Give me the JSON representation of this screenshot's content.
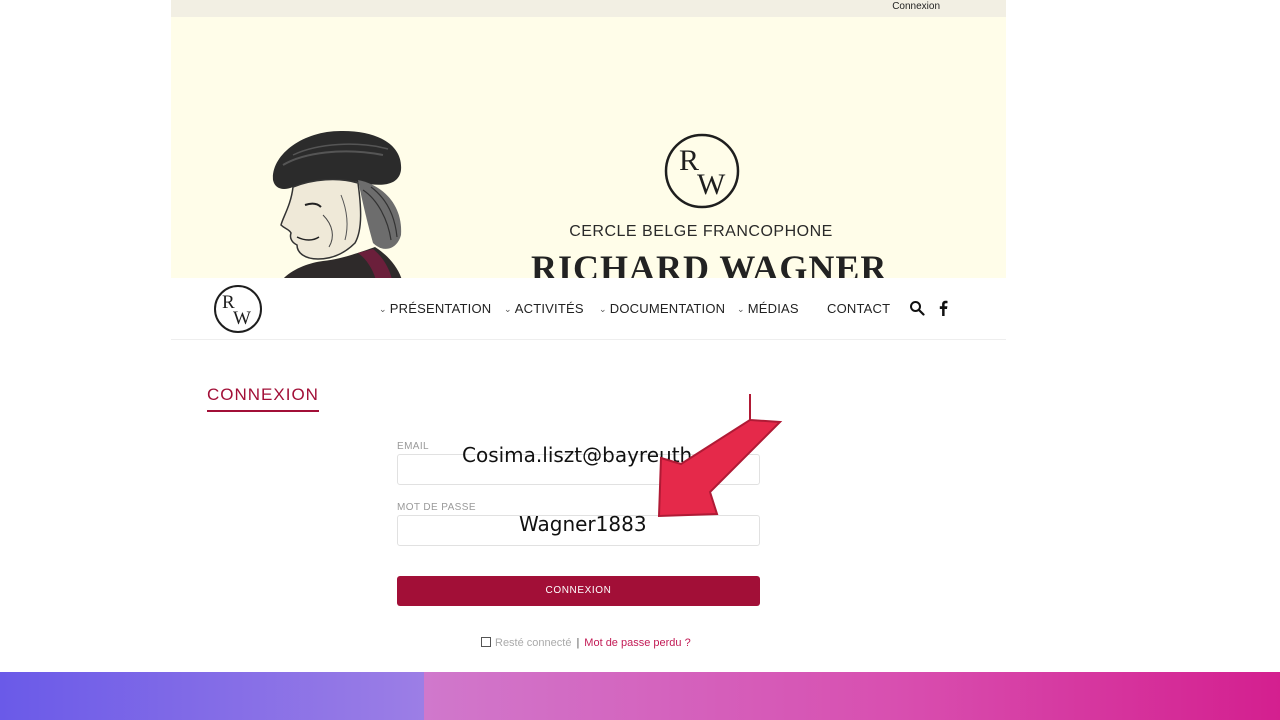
{
  "topbar": {
    "login_link": "Connexion"
  },
  "banner": {
    "logo_text": "RW",
    "subtitle": "CERCLE BELGE FRANCOPHONE",
    "title": "RICHARD WAGNER"
  },
  "nav": {
    "logo_text": "RW",
    "items": [
      {
        "label": "PRÉSENTATION",
        "has_dropdown": true
      },
      {
        "label": "ACTIVITÉS",
        "has_dropdown": true
      },
      {
        "label": "DOCUMENTATION",
        "has_dropdown": true
      },
      {
        "label": "MÉDIAS",
        "has_dropdown": true
      },
      {
        "label": "CONTACT",
        "has_dropdown": false
      }
    ],
    "icons": [
      "search-icon",
      "facebook-icon"
    ]
  },
  "form": {
    "section_title": "CONNEXION",
    "email_label": "EMAIL",
    "email_value": "",
    "password_label": "MOT DE PASSE",
    "password_value": "",
    "submit_label": "CONNEXION",
    "remember_label": "Resté connecté",
    "separator": "|",
    "lost_password_link": "Mot de passe perdu ?"
  },
  "annotations": {
    "email_overlay": "Cosima.liszt@bayreuth",
    "password_overlay": "Wagner1883"
  },
  "colors": {
    "accent": "#a20f37",
    "link": "#c21a55",
    "banner_bg": "#fffde9",
    "arrow": "#e5294a"
  }
}
